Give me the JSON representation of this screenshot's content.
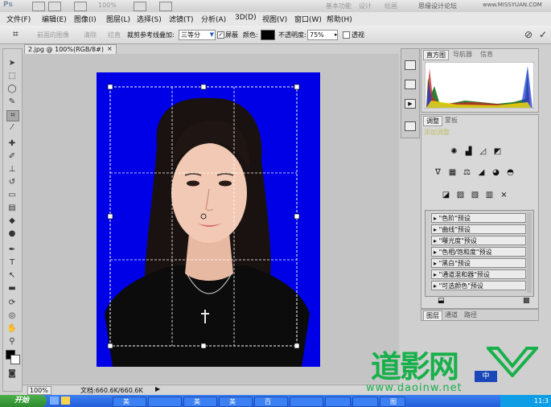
{
  "title_bar": {
    "app_icon": "Ps",
    "zoom_value": "100%",
    "right_texts": [
      "基本功能",
      "设计",
      "绘画"
    ],
    "site_tag": "思缘设计论坛",
    "site_url": "www.MISSYUAN.COM"
  },
  "menu": [
    "文件(F)",
    "编辑(E)",
    "图像(I)",
    "图层(L)",
    "选择(S)",
    "滤镜(T)",
    "分析(A)",
    "3D(D)",
    "视图(V)",
    "窗口(W)",
    "帮助(H)"
  ],
  "options_bar": {
    "front_image": "前面的图像",
    "clear": "清除",
    "straighten": "拉直",
    "overlay_label": "裁剪参考线叠加:",
    "overlay_value": "三等分",
    "shield_label": "屏蔽",
    "color_label": "颜色:",
    "opacity_label": "不透明度:",
    "opacity_value": "75%",
    "perspective_label": "透视"
  },
  "document": {
    "tab_label": "2.jpg @ 100%(RGB/8#)",
    "close": "×"
  },
  "status": {
    "zoom": "100%",
    "doc_size": "文档:660.6K/660.6K"
  },
  "panels": {
    "hist_tabs": [
      "直方图",
      "导航器",
      "信息"
    ],
    "adj_tabs": [
      "调整",
      "蒙板"
    ],
    "adj_hint": "添加调整",
    "presets": [
      "\"色阶\"预设",
      "\"曲线\"预设",
      "\"曝光度\"预设",
      "\"色相/饱和度\"预设",
      "\"黑白\"预设",
      "\"通道混和器\"预设",
      "\"可选颜色\"预设"
    ],
    "layer_tabs": [
      "图层",
      "通道",
      "路径"
    ]
  },
  "taskbar": {
    "start_label": "开始",
    "tasks": [
      "美",
      "",
      "美",
      "美",
      "百",
      "",
      "",
      "",
      "图",
      "",
      ""
    ],
    "ime_label": "中",
    "clock": "11:3"
  },
  "watermark": {
    "brand": "道影网",
    "url": "www.daoinw.net"
  },
  "colors": {
    "photo_bg": "#0000e6",
    "taskbar": "#245edb",
    "watermark": "#18b04a"
  }
}
